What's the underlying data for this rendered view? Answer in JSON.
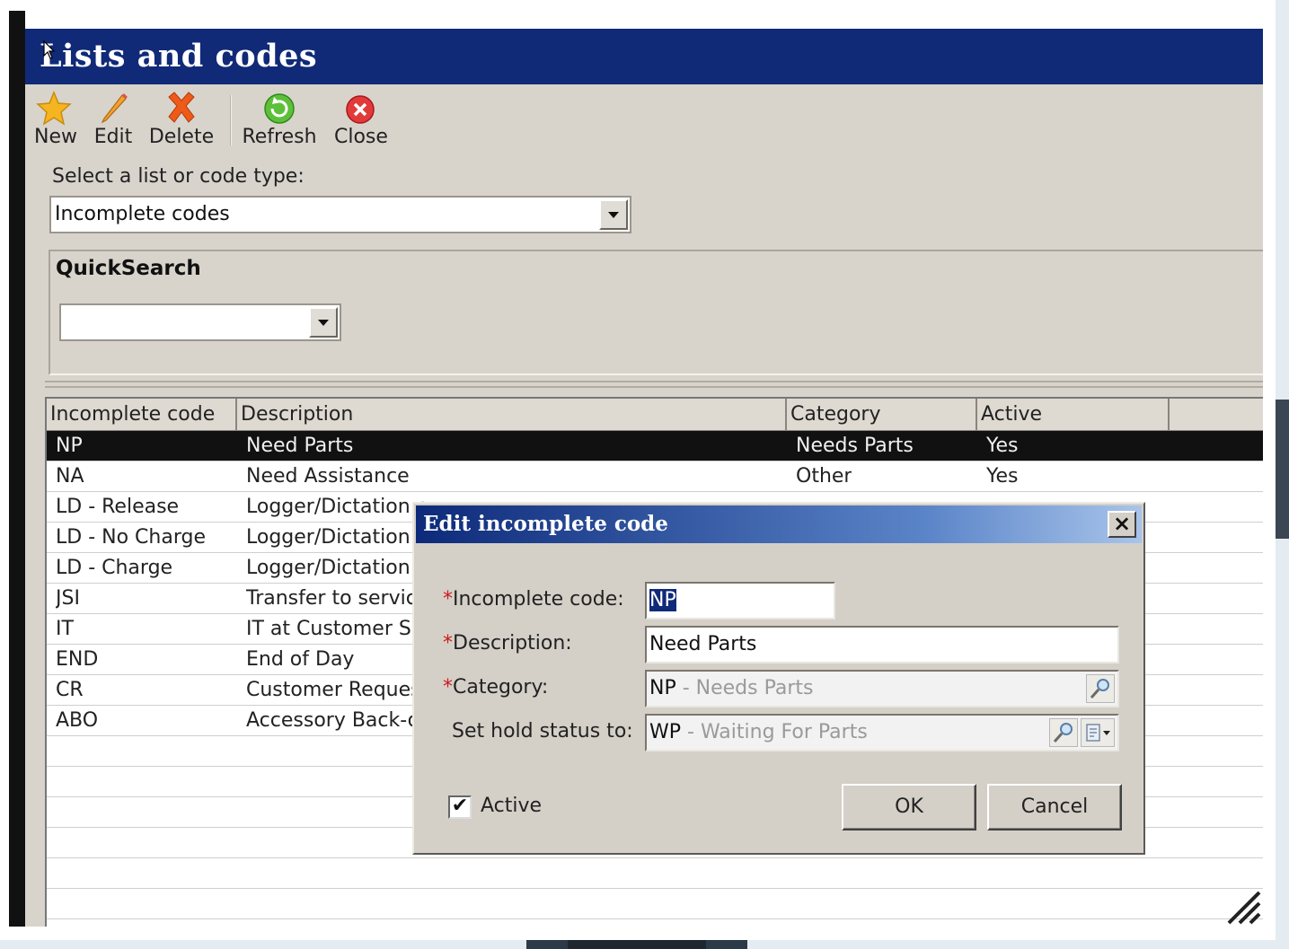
{
  "window": {
    "title": "Lists and codes"
  },
  "toolbar": {
    "new_label": "New",
    "edit_label": "Edit",
    "delete_label": "Delete",
    "refresh_label": "Refresh",
    "close_label": "Close"
  },
  "list_type": {
    "label": "Select a list or code type:",
    "selected": "Incomplete codes"
  },
  "quicksearch": {
    "title": "QuickSearch",
    "value": ""
  },
  "grid": {
    "columns": [
      "Incomplete code",
      "Description",
      "Category",
      "Active"
    ],
    "rows": [
      {
        "code": "NP",
        "description": "Need Parts",
        "category": "Needs Parts",
        "active": "Yes",
        "selected": true
      },
      {
        "code": "NA",
        "description": "Need Assistance",
        "category": "Other",
        "active": "Yes"
      },
      {
        "code": "LD - Release",
        "description": "Logger/Dictation c...",
        "category": "",
        "active": ""
      },
      {
        "code": "LD - No Charge",
        "description": "Logger/Dictation -",
        "category": "",
        "active": ""
      },
      {
        "code": "LD - Charge",
        "description": "Logger/Dictation C",
        "category": "",
        "active": ""
      },
      {
        "code": "JSI",
        "description": "Transfer to servic",
        "category": "",
        "active": ""
      },
      {
        "code": "IT",
        "description": "IT at Customer Sit",
        "category": "",
        "active": ""
      },
      {
        "code": "END",
        "description": "End of Day",
        "category": "",
        "active": ""
      },
      {
        "code": "CR",
        "description": "Customer Reques",
        "category": "",
        "active": ""
      },
      {
        "code": "ABO",
        "description": "Accessory Back-or",
        "category": "",
        "active": ""
      }
    ]
  },
  "dialog": {
    "title": "Edit incomplete code",
    "close_glyph": "×",
    "code_label": "Incomplete code:",
    "code_value": "NP",
    "description_label": "Description:",
    "description_value": "Need Parts",
    "category_label": "Category:",
    "category_code": "NP",
    "category_name": " - Needs Parts",
    "hold_label": "Set hold status to:",
    "hold_code": "WP",
    "hold_name": " - Waiting For Parts",
    "required_mark": "*",
    "active_label": "Active",
    "active_checked": true,
    "check_glyph": "✔",
    "ok_label": "OK",
    "cancel_label": "Cancel"
  },
  "colors": {
    "title_bar": "#102a78",
    "selection": "#111111",
    "required": "#cc1a1a"
  }
}
